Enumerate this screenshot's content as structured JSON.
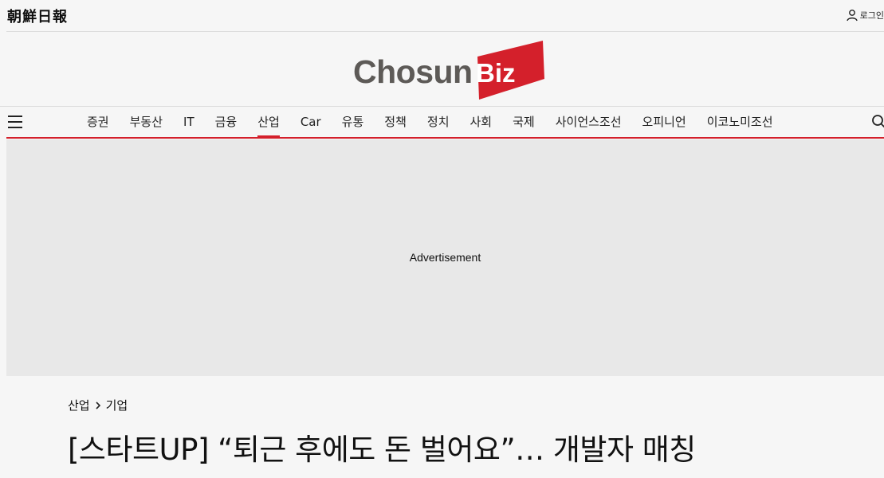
{
  "topbar": {
    "brand_hanja": "朝鮮日報",
    "login_label": "로그인"
  },
  "logo": {
    "part1": "Chosun",
    "part2": "Biz",
    "colors": {
      "text": "#5d5a57",
      "accent": "#d4202b"
    }
  },
  "nav": {
    "items": [
      "증권",
      "부동산",
      "IT",
      "금융",
      "산업",
      "Car",
      "유통",
      "정책",
      "정치",
      "사회",
      "국제",
      "사이언스조선",
      "오피니언",
      "이코노미조선"
    ],
    "active_index": 4
  },
  "ad": {
    "label": "Advertisement"
  },
  "article": {
    "breadcrumb": {
      "section": "산업",
      "subsection": "기업"
    },
    "headline": "[스타트UP] “퇴근 후에도 돈 벌어요”… 개발자 매칭"
  }
}
